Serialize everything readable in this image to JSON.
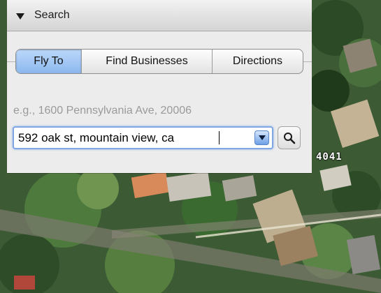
{
  "panel": {
    "title": "Search"
  },
  "tabs": [
    {
      "label": "Fly To",
      "active": true
    },
    {
      "label": "Find Businesses",
      "active": false
    },
    {
      "label": "Directions",
      "active": false
    }
  ],
  "search": {
    "hint": "e.g., 1600 Pennsylvania Ave, 20006",
    "value": "592 oak st, mountain view, ca"
  },
  "map": {
    "label": "4041"
  },
  "icons": {
    "disclosure": "disclosure-triangle-down-icon",
    "dropdown": "chevron-down-icon",
    "search": "magnifier-icon"
  },
  "colors": {
    "active_tab": "#9fc5f5",
    "focus_ring": "#7fa7e3",
    "panel_bg": "#ececec"
  }
}
